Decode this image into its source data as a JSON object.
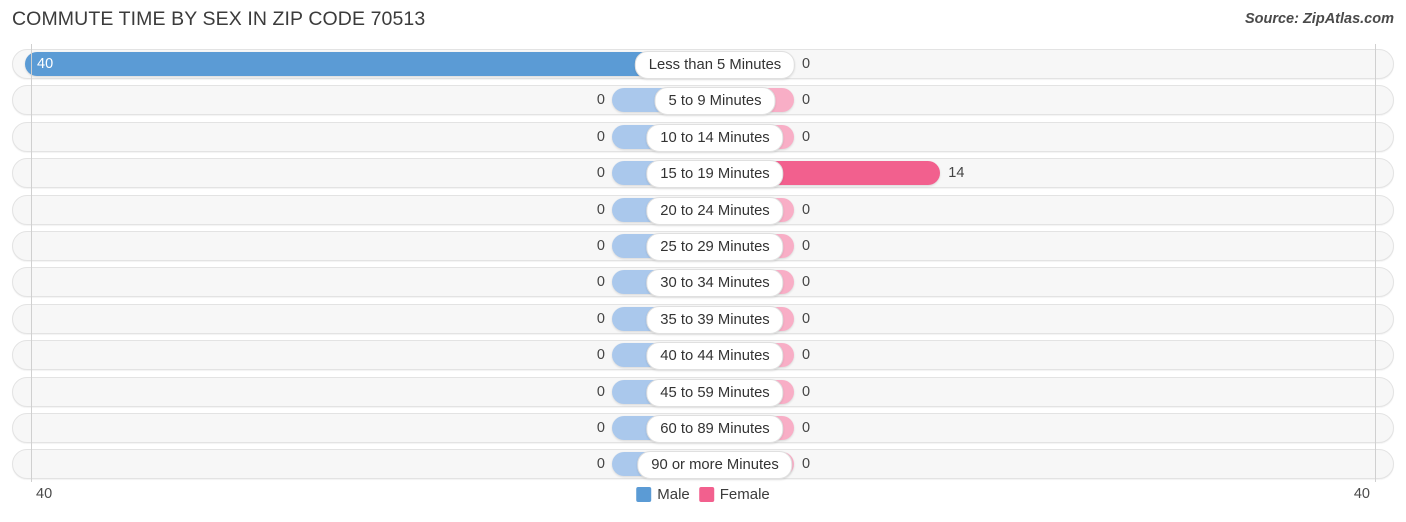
{
  "header": {
    "title": "COMMUTE TIME BY SEX IN ZIP CODE 70513",
    "source": "Source: ZipAtlas.com"
  },
  "legend": {
    "male_label": "Male",
    "female_label": "Female",
    "male_color": "#5b9bd5",
    "female_color": "#f2608e",
    "male_zero_color": "#aac8ec",
    "female_zero_color": "#f8aec6"
  },
  "axis": {
    "left_tick": "40",
    "right_tick": "40",
    "max": 40
  },
  "chart_data": {
    "type": "bar",
    "orientation": "horizontal-diverging",
    "title": "COMMUTE TIME BY SEX IN ZIP CODE 70513",
    "xlabel": "",
    "ylabel": "",
    "xlim": [
      40,
      40
    ],
    "grid": false,
    "legend_position": "bottom-center",
    "categories": [
      "Less than 5 Minutes",
      "5 to 9 Minutes",
      "10 to 14 Minutes",
      "15 to 19 Minutes",
      "20 to 24 Minutes",
      "25 to 29 Minutes",
      "30 to 34 Minutes",
      "35 to 39 Minutes",
      "40 to 44 Minutes",
      "45 to 59 Minutes",
      "60 to 89 Minutes",
      "90 or more Minutes"
    ],
    "series": [
      {
        "name": "Male",
        "values": [
          40,
          0,
          0,
          0,
          0,
          0,
          0,
          0,
          0,
          0,
          0,
          0
        ]
      },
      {
        "name": "Female",
        "values": [
          0,
          0,
          0,
          14,
          0,
          0,
          0,
          0,
          0,
          0,
          0,
          0
        ]
      }
    ]
  },
  "rows": [
    {
      "label": "Less than 5 Minutes",
      "male": "40",
      "female": "0"
    },
    {
      "label": "5 to 9 Minutes",
      "male": "0",
      "female": "0"
    },
    {
      "label": "10 to 14 Minutes",
      "male": "0",
      "female": "0"
    },
    {
      "label": "15 to 19 Minutes",
      "male": "0",
      "female": "14"
    },
    {
      "label": "20 to 24 Minutes",
      "male": "0",
      "female": "0"
    },
    {
      "label": "25 to 29 Minutes",
      "male": "0",
      "female": "0"
    },
    {
      "label": "30 to 34 Minutes",
      "male": "0",
      "female": "0"
    },
    {
      "label": "35 to 39 Minutes",
      "male": "0",
      "female": "0"
    },
    {
      "label": "40 to 44 Minutes",
      "male": "0",
      "female": "0"
    },
    {
      "label": "45 to 59 Minutes",
      "male": "0",
      "female": "0"
    },
    {
      "label": "60 to 89 Minutes",
      "male": "0",
      "female": "0"
    },
    {
      "label": "90 or more Minutes",
      "male": "0",
      "female": "0"
    }
  ]
}
